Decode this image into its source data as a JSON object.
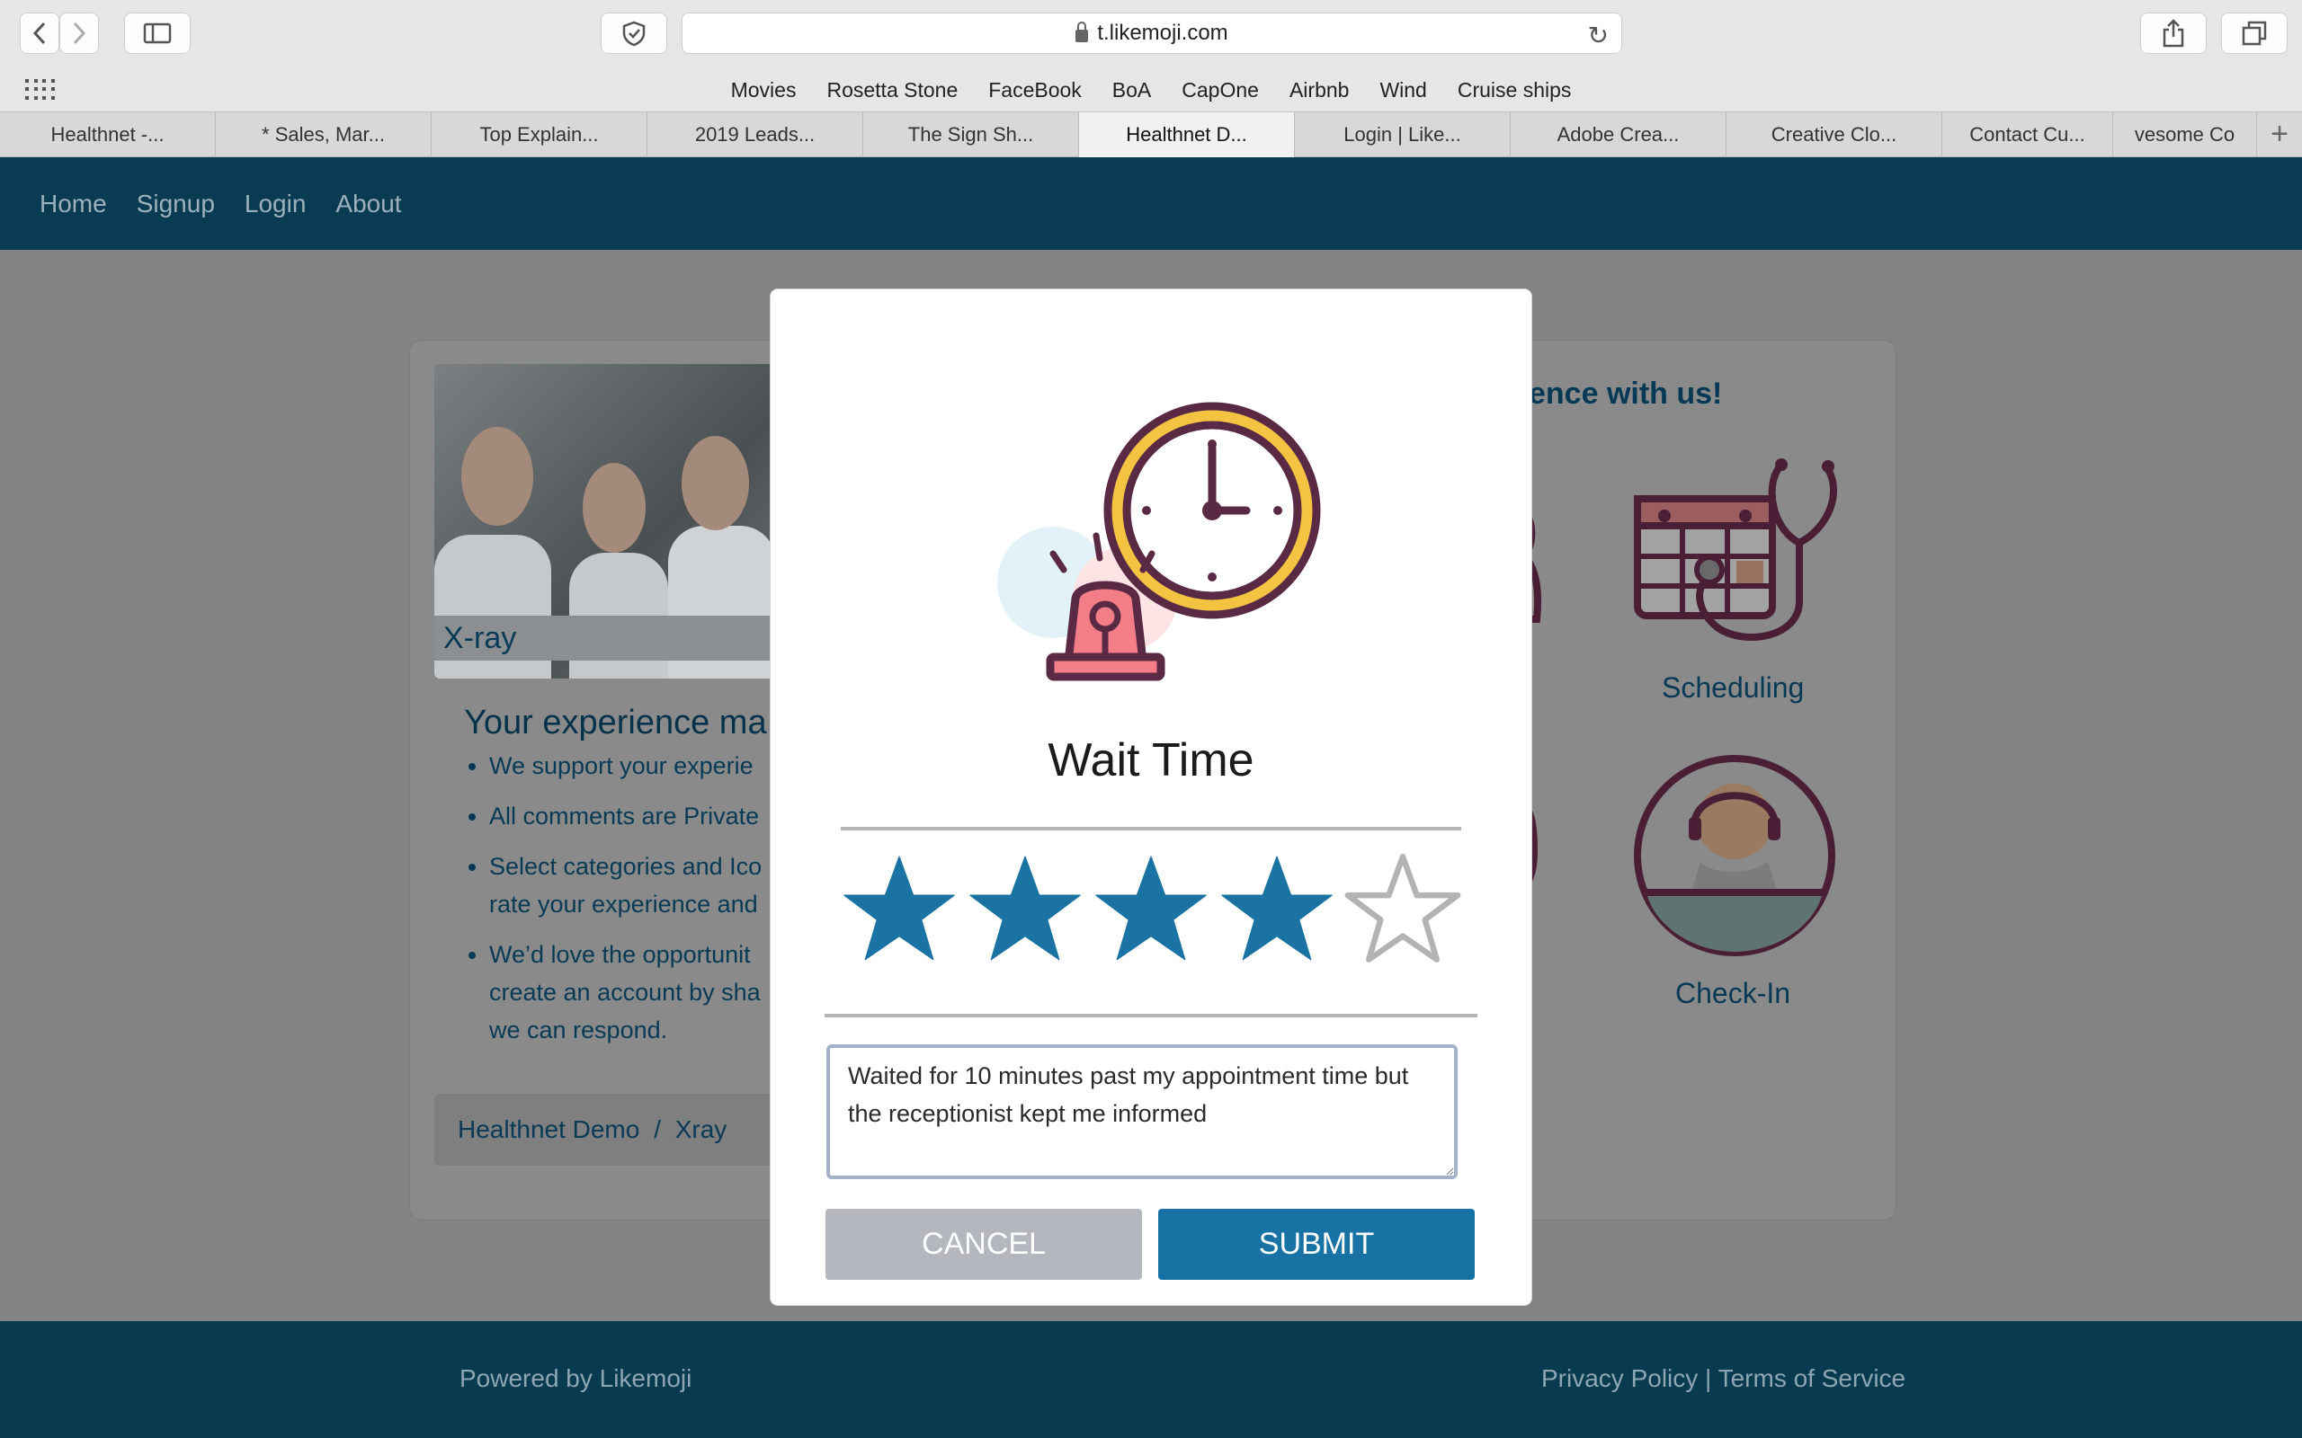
{
  "browser": {
    "url": "t.likemoji.com",
    "bookmarks": [
      "Movies",
      "Rosetta Stone",
      "FaceBook",
      "BoA",
      "CapOne",
      "Airbnb",
      "Wind",
      "Cruise ships"
    ],
    "tabs": [
      "Healthnet -...",
      "* Sales, Mar...",
      "Top Explain...",
      "2019 Leads...",
      "The Sign Sh...",
      "Healthnet D...",
      "Login | Like...",
      "Adobe Crea...",
      "Creative Clo...",
      "Contact Cu...",
      "vesome Co"
    ],
    "active_tab_index": 5
  },
  "site_nav": {
    "items": [
      "Home",
      "Signup",
      "Login",
      "About"
    ]
  },
  "background_page": {
    "photo_caption": "X-ray",
    "experience_title": "Your experience ma",
    "bullets": [
      "We support your experie",
      "All comments are Private",
      "Select categories and Ico",
      "rate your experience and",
      "We’d love the opportunit",
      "create an account by sha",
      "we can respond."
    ],
    "breadcrumb": {
      "root": "Healthnet Demo",
      "separator": "/",
      "current": "Xray"
    },
    "share_title": "ence with us!",
    "icon_labels": [
      "Scheduling",
      "Check-In"
    ]
  },
  "modal": {
    "title": "Wait Time",
    "rating": 4,
    "max_rating": 5,
    "star_color": "#1a73a3",
    "comment": "Waited for 10 minutes past my appointment time but the receptionist kept me informed",
    "cancel_label": "CANCEL",
    "submit_label": "SUBMIT"
  },
  "footer": {
    "powered_by": "Powered by Likemoji",
    "privacy": "Privacy Policy",
    "separator": "|",
    "terms": "Terms of Service"
  },
  "colors": {
    "nav_bg": "#093c53",
    "brand_blue": "#1872a3",
    "cancel_gray": "#b4b8be"
  }
}
